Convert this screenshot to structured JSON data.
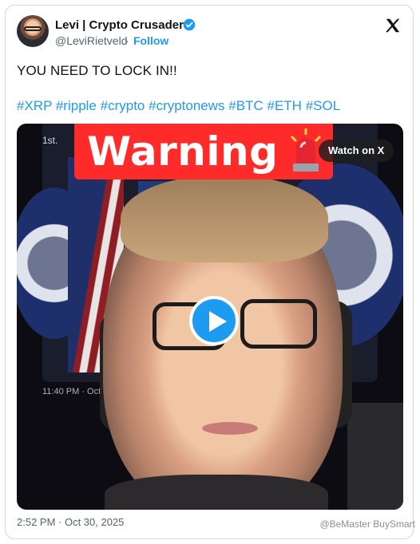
{
  "tweet": {
    "author_name": "Levi | Crypto Crusaders",
    "author_handle": "@LeviRietveld",
    "separator": "·",
    "follow_label": "Follow",
    "text": "YOU NEED TO LOCK IN!!",
    "hashtags": [
      "#XRP",
      "#ripple",
      "#crypto",
      "#cryptonews",
      "#BTC",
      "#ETH",
      "#SOL"
    ],
    "timestamp": "2:52 PM · Oct 30, 2025",
    "verified_icon": "verified-badge-icon",
    "platform_icon": "x-logo-icon"
  },
  "video": {
    "banner_text": "Warning",
    "banner_emoji": "siren-icon",
    "watch_label": "Watch on X",
    "play_icon": "play-icon",
    "inset_date": "1st.",
    "inset_time": "11:40 PM · Oct 2"
  },
  "overlay": {
    "watermark": "@BeMaster BuySmart"
  },
  "colors": {
    "accent": "#1d9bf0",
    "warning": "#ff2a2a"
  }
}
